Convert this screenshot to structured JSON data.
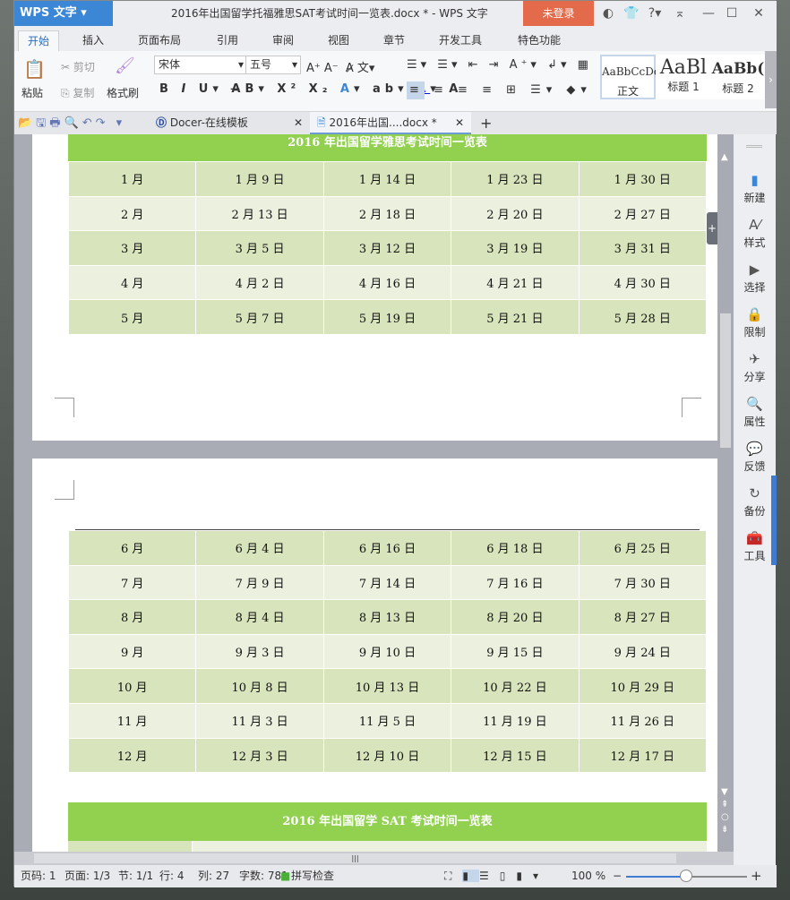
{
  "app": {
    "logo": "WPS 文字",
    "title": "2016年出国留学托福雅思SAT考试时间一览表.docx * - WPS 文字",
    "login": "未登录"
  },
  "ribbon_tabs": [
    "开始",
    "插入",
    "页面布局",
    "引用",
    "审阅",
    "视图",
    "章节",
    "开发工具",
    "特色功能"
  ],
  "ribbon": {
    "paste": "粘贴",
    "cut": "剪切",
    "copy": "复制",
    "format_painter": "格式刷",
    "font": "宋体",
    "size": "五号",
    "styles": [
      {
        "preview": "AaBbCcDd",
        "label": "正文"
      },
      {
        "preview": "AaBl",
        "label": "标题 1"
      },
      {
        "preview": "AaBb(",
        "label": "标题 2"
      }
    ]
  },
  "doc_tabs": [
    {
      "label": "Docer-在线模板"
    },
    {
      "label": "2016年出国....docx *"
    }
  ],
  "ielts_table": {
    "title": "2016 年出国留学雅思考试时间一览表",
    "rows": [
      [
        "1 月",
        "1 月 9 日",
        "1 月 14 日",
        "1 月 23 日",
        "1 月 30 日"
      ],
      [
        "2 月",
        "2 月 13 日",
        "2 月 18 日",
        "2 月 20 日",
        "2 月 27 日"
      ],
      [
        "3 月",
        "3 月 5 日",
        "3 月 12 日",
        "3 月 19 日",
        "3 月 31 日"
      ],
      [
        "4 月",
        "4 月 2 日",
        "4 月 16 日",
        "4 月 21 日",
        "4 月 30 日"
      ],
      [
        "5 月",
        "5 月 7 日",
        "5 月 19 日",
        "5 月 21 日",
        "5 月 28 日"
      ]
    ],
    "rows_page2": [
      [
        "6 月",
        "6 月 4 日",
        "6 月 16 日",
        "6 月 18 日",
        "6 月 25 日"
      ],
      [
        "7 月",
        "7 月 9 日",
        "7 月 14 日",
        "7 月 16 日",
        "7 月 30 日"
      ],
      [
        "8 月",
        "8 月 4 日",
        "8 月 13 日",
        "8 月 20 日",
        "8 月 27 日"
      ],
      [
        "9 月",
        "9 月 3 日",
        "9 月 10 日",
        "9 月 15 日",
        "9 月 24 日"
      ],
      [
        "10 月",
        "10 月 8 日",
        "10 月 13 日",
        "10 月 22 日",
        "10 月 29 日"
      ],
      [
        "11 月",
        "11 月 3 日",
        "11 月 5 日",
        "11 月 19 日",
        "11 月 26 日"
      ],
      [
        "12 月",
        "12 月 3 日",
        "12 月 10 日",
        "12 月 15 日",
        "12 月 17 日"
      ]
    ]
  },
  "sat_table": {
    "title": "2016 年出国留学 SAT 考试时间一览表"
  },
  "sidebar": [
    {
      "label": "新建",
      "icon": "new-doc-icon",
      "g": "▮"
    },
    {
      "label": "样式",
      "icon": "style-icon",
      "g": "A⁄"
    },
    {
      "label": "选择",
      "icon": "select-icon",
      "g": "▶"
    },
    {
      "label": "限制",
      "icon": "lock-icon",
      "g": "🔒"
    },
    {
      "label": "分享",
      "icon": "share-icon",
      "g": "✈"
    },
    {
      "label": "属性",
      "icon": "properties-icon",
      "g": "🔍"
    },
    {
      "label": "反馈",
      "icon": "feedback-icon",
      "g": "💬"
    },
    {
      "label": "备份",
      "icon": "backup-icon",
      "g": "↻"
    },
    {
      "label": "工具",
      "icon": "toolbox-icon",
      "g": "🧰"
    }
  ],
  "status": {
    "page_no": "页码: 1",
    "pages": "页面: 1/3",
    "section": "节: 1/1",
    "row": "行: 4",
    "col": "列: 27",
    "words": "字数: 781",
    "spell": "拼写检查",
    "zoom": "100 %",
    "zoom_level": 100
  }
}
